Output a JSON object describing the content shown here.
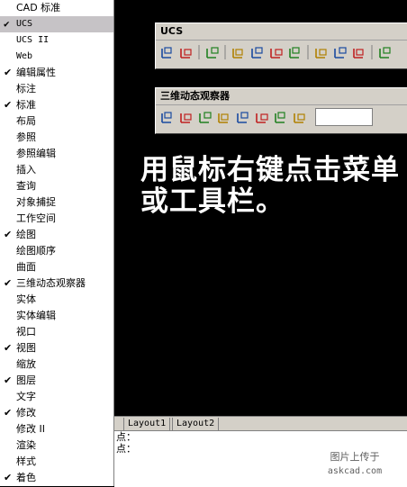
{
  "menu": {
    "items": [
      {
        "label": "CAD 标准",
        "checked": false,
        "selected": false,
        "latin": false
      },
      {
        "label": "UCS",
        "checked": true,
        "selected": true,
        "latin": true
      },
      {
        "label": "UCS II",
        "checked": false,
        "selected": false,
        "latin": true
      },
      {
        "label": "Web",
        "checked": false,
        "selected": false,
        "latin": true
      },
      {
        "label": "编辑属性",
        "checked": true,
        "selected": false,
        "latin": false
      },
      {
        "label": "标注",
        "checked": false,
        "selected": false,
        "latin": false
      },
      {
        "label": "标准",
        "checked": true,
        "selected": false,
        "latin": false
      },
      {
        "label": "布局",
        "checked": false,
        "selected": false,
        "latin": false
      },
      {
        "label": "参照",
        "checked": false,
        "selected": false,
        "latin": false
      },
      {
        "label": "参照编辑",
        "checked": false,
        "selected": false,
        "latin": false
      },
      {
        "label": "插入",
        "checked": false,
        "selected": false,
        "latin": false
      },
      {
        "label": "查询",
        "checked": false,
        "selected": false,
        "latin": false
      },
      {
        "label": "对象捕捉",
        "checked": false,
        "selected": false,
        "latin": false
      },
      {
        "label": "工作空间",
        "checked": false,
        "selected": false,
        "latin": false
      },
      {
        "label": "绘图",
        "checked": true,
        "selected": false,
        "latin": false
      },
      {
        "label": "绘图顺序",
        "checked": false,
        "selected": false,
        "latin": false
      },
      {
        "label": "曲面",
        "checked": false,
        "selected": false,
        "latin": false
      },
      {
        "label": "三维动态观察器",
        "checked": true,
        "selected": false,
        "latin": false
      },
      {
        "label": "实体",
        "checked": false,
        "selected": false,
        "latin": false
      },
      {
        "label": "实体编辑",
        "checked": false,
        "selected": false,
        "latin": false
      },
      {
        "label": "视口",
        "checked": false,
        "selected": false,
        "latin": false
      },
      {
        "label": "视图",
        "checked": true,
        "selected": false,
        "latin": false
      },
      {
        "label": "缩放",
        "checked": false,
        "selected": false,
        "latin": false
      },
      {
        "label": "图层",
        "checked": true,
        "selected": false,
        "latin": false
      },
      {
        "label": "文字",
        "checked": false,
        "selected": false,
        "latin": false
      },
      {
        "label": "修改",
        "checked": true,
        "selected": false,
        "latin": false
      },
      {
        "label": "修改 II",
        "checked": false,
        "selected": false,
        "latin": false
      },
      {
        "label": "渲染",
        "checked": false,
        "selected": false,
        "latin": false
      },
      {
        "label": "样式",
        "checked": false,
        "selected": false,
        "latin": false
      },
      {
        "label": "着色",
        "checked": true,
        "selected": false,
        "latin": false
      }
    ]
  },
  "check_glyph": "✔",
  "toolbar_ucs": {
    "title": "UCS",
    "icons": [
      "ucs-icon",
      "named-ucs-icon",
      "|",
      "previous-ucs-icon",
      "|",
      "world-ucs-icon",
      "object-ucs-icon",
      "face-ucs-icon",
      "view-ucs-icon",
      "|",
      "origin-ucs-icon",
      "z-axis-vector-icon",
      "3point-ucs-icon",
      "|",
      "x-rotate-icon"
    ]
  },
  "toolbar_orbit": {
    "title": "三维动态观察器",
    "icons": [
      "3d-pan-icon",
      "3d-zoom-icon",
      "3d-orbit-icon",
      "continuous-orbit-icon",
      "swivel-icon",
      "adjust-distance-icon",
      "front-clip-icon",
      "back-clip-icon"
    ]
  },
  "instruction": "用鼠标右键点击菜单或工具栏。",
  "tabs": [
    "Layout1",
    "Layout2"
  ],
  "command_lines": [
    "点：",
    "点："
  ],
  "watermark": {
    "line1": "图片上传于",
    "line2": "askcad.com"
  }
}
